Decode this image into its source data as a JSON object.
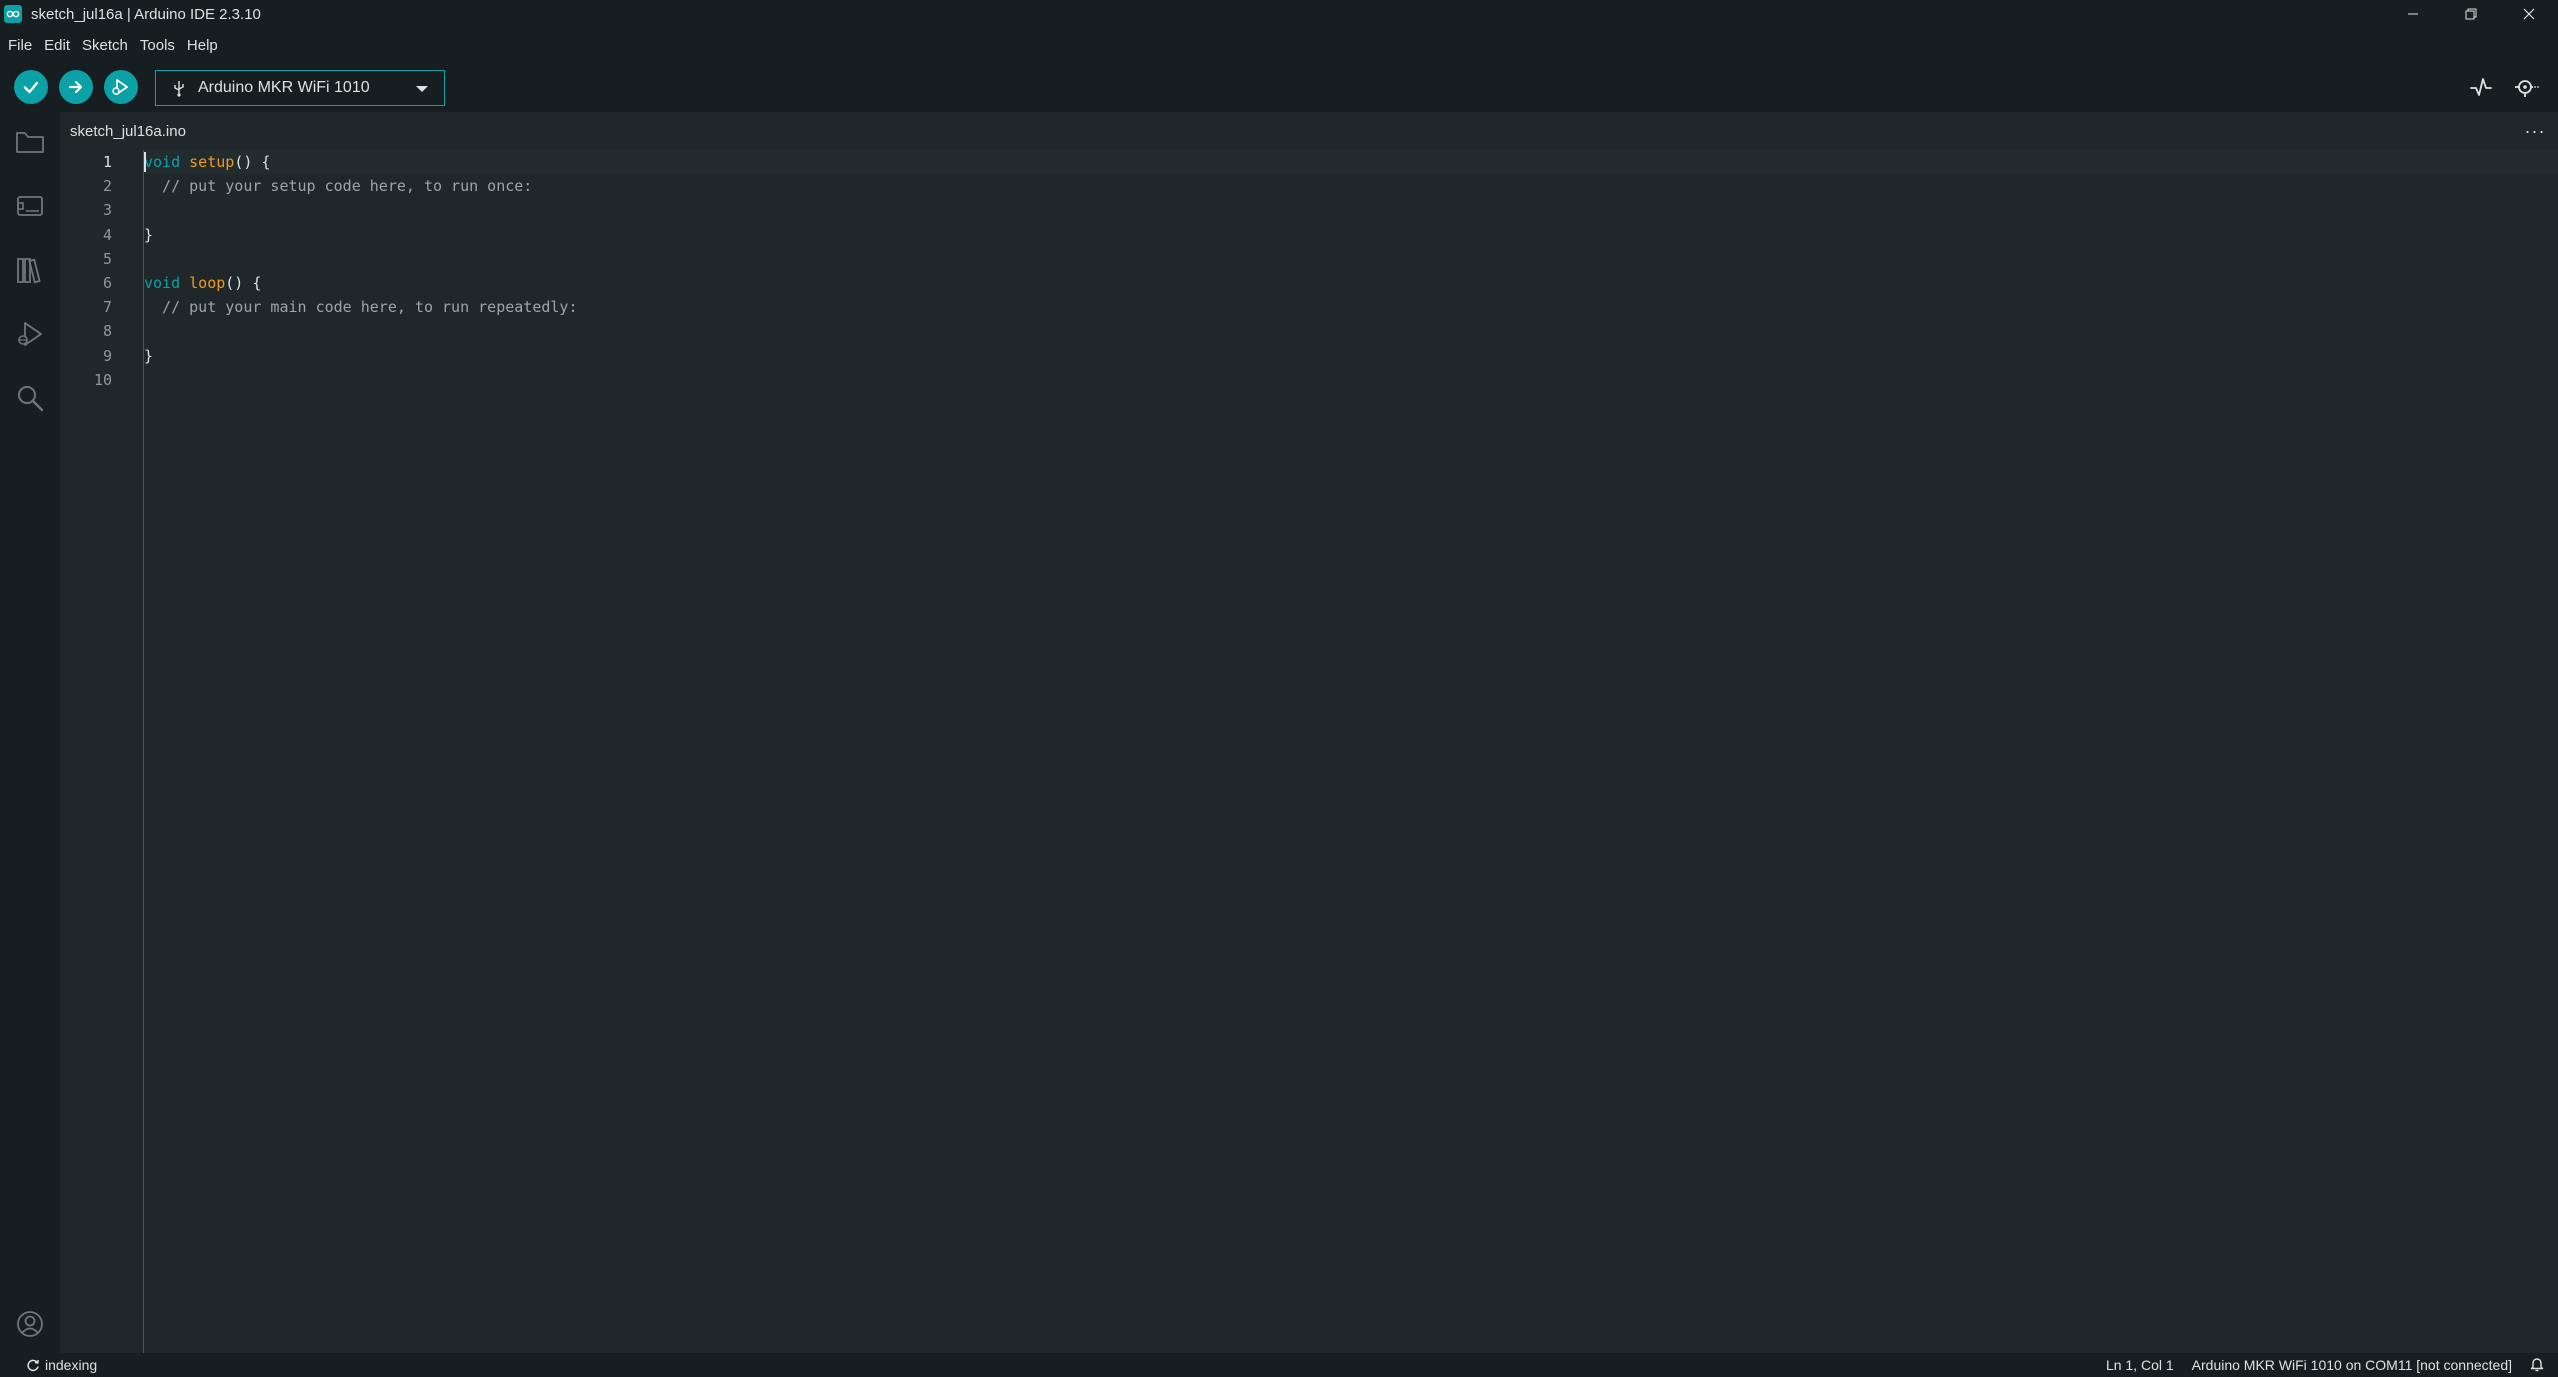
{
  "window": {
    "title": "sketch_jul16a | Arduino IDE 2.3.10",
    "controls": {
      "minimize": "—",
      "restore": "❐",
      "close": "✕"
    }
  },
  "menu": {
    "items": [
      "File",
      "Edit",
      "Sketch",
      "Tools",
      "Help"
    ]
  },
  "toolbar": {
    "verify_icon": "check-icon",
    "upload_icon": "arrow-right-icon",
    "debug_icon": "debugger-icon",
    "board_label": "Arduino MKR WiFi 1010",
    "serial_plotter_icon": "pulse-icon",
    "serial_monitor_icon": "serial-monitor-icon"
  },
  "activity_bar": {
    "icons": [
      "folder-icon",
      "board-icon",
      "library-icon",
      "debug-icon",
      "search-icon",
      "account-icon"
    ]
  },
  "editor": {
    "tab_label": "sketch_jul16a.ino",
    "more_label": "···",
    "lines": [
      {
        "no": "1",
        "parts": [
          {
            "t": "kw",
            "s": "void"
          },
          {
            "t": "punc",
            "s": " "
          },
          {
            "t": "fn",
            "s": "setup"
          },
          {
            "t": "punc",
            "s": "() {"
          }
        ]
      },
      {
        "no": "2",
        "parts": [
          {
            "t": "cm",
            "s": "  // put your setup code here, to run once:"
          }
        ]
      },
      {
        "no": "3",
        "parts": []
      },
      {
        "no": "4",
        "parts": [
          {
            "t": "punc",
            "s": "}"
          }
        ]
      },
      {
        "no": "5",
        "parts": []
      },
      {
        "no": "6",
        "parts": [
          {
            "t": "kw",
            "s": "void"
          },
          {
            "t": "punc",
            "s": " "
          },
          {
            "t": "fn",
            "s": "loop"
          },
          {
            "t": "punc",
            "s": "() {"
          }
        ]
      },
      {
        "no": "7",
        "parts": [
          {
            "t": "cm",
            "s": "  // put your main code here, to run repeatedly:"
          }
        ]
      },
      {
        "no": "8",
        "parts": []
      },
      {
        "no": "9",
        "parts": [
          {
            "t": "punc",
            "s": "}"
          }
        ]
      },
      {
        "no": "10",
        "parts": []
      }
    ]
  },
  "status": {
    "indexing": "indexing",
    "cursor": "Ln 1, Col 1",
    "board_port": "Arduino MKR WiFi 1010 on COM11 [not connected]"
  },
  "colors": {
    "accent": "#0ca1a6",
    "function": "#f39c12",
    "comment": "#9ba5a7",
    "chrome": "#171e21",
    "editor_bg": "#1f272a"
  }
}
